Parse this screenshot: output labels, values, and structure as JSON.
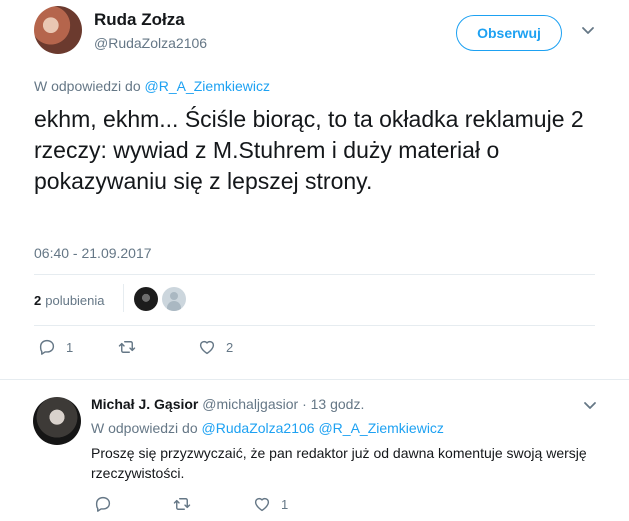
{
  "tweet": {
    "display_name": "Ruda Zołza",
    "handle": "@RudaZolza2106",
    "follow_label": "Obserwuj",
    "reply_prefix": "W odpowiedzi do",
    "reply_to": "@R_A_Ziemkiewicz",
    "text": "ekhm, ekhm... Ściśle biorąc, to ta okładka reklamuje 2 rzeczy: wywiad z M.Stuhrem i duży materiał o pokazywaniu się z lepszej strony.",
    "timestamp": "06:40 - 21.09.2017",
    "likes_count": "2",
    "likes_label": "polubienia",
    "actions": {
      "reply_count": "1",
      "retweet_count": "",
      "like_count": "2"
    }
  },
  "reply": {
    "display_name": "Michał J. Gąsior",
    "handle": "@michaljgasior",
    "dot": "·",
    "time": "13 godz.",
    "reply_prefix": "W odpowiedzi do",
    "reply_to_1": "@RudaZolza2106",
    "reply_to_2": "@R_A_Ziemkiewicz",
    "text": "Proszę się przyzwyczaić, że pan redaktor już od dawna komentuje swoją wersję rzeczywistości.",
    "actions": {
      "reply_count": "",
      "retweet_count": "",
      "like_count": "1"
    }
  },
  "icons": {
    "reply": "reply-icon",
    "retweet": "retweet-icon",
    "like": "heart-icon",
    "more": "chevron-down-icon"
  },
  "colors": {
    "accent": "#1da1f2",
    "secondary_text": "#657786",
    "divider": "#e6ecf0"
  }
}
